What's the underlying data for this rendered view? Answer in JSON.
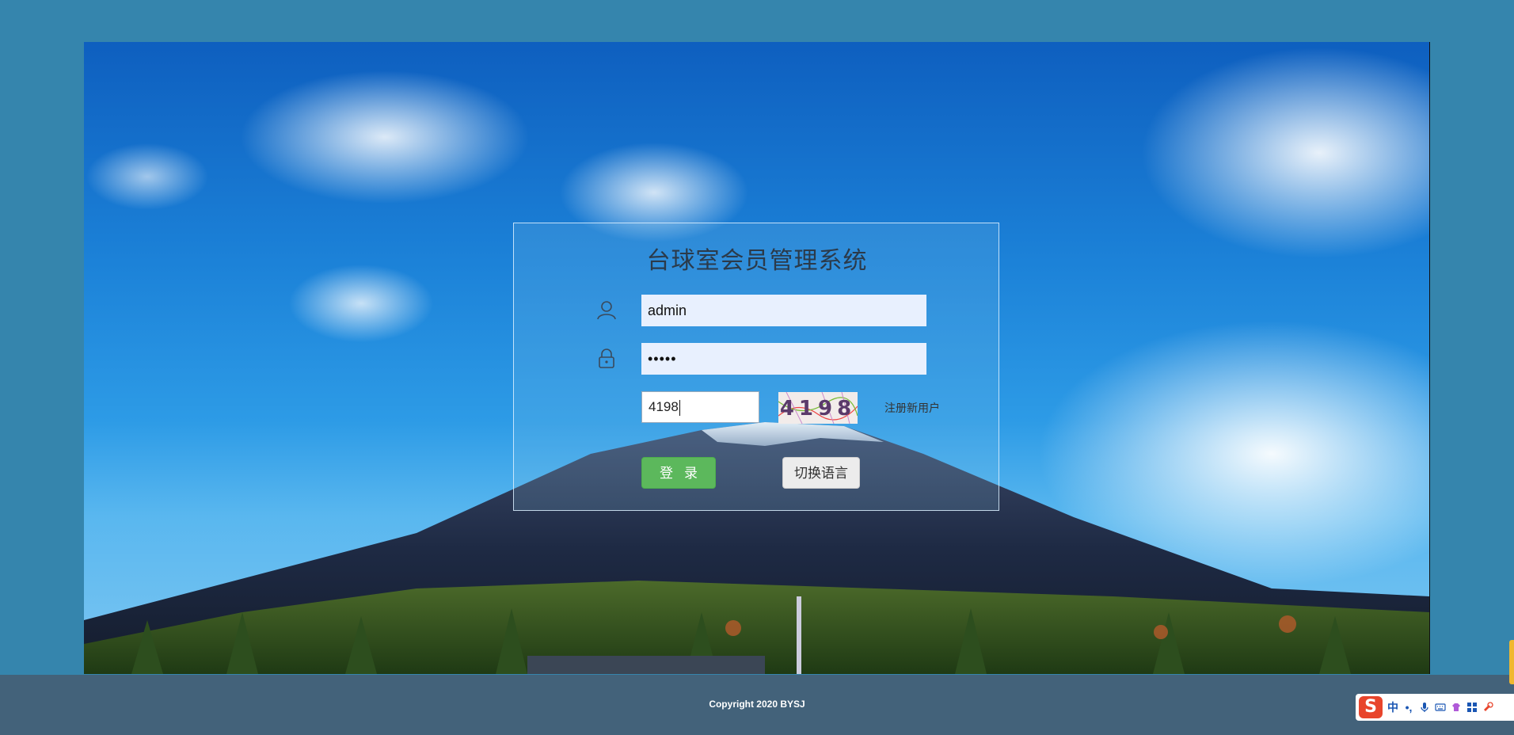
{
  "login": {
    "title": "台球室会员管理系统",
    "username_value": "admin",
    "password_value": "•••••",
    "captcha_value": "4198",
    "captcha_image_text": "4198",
    "register_label": "注册新用户",
    "login_button_label": "登录",
    "language_button_label": "切换语言"
  },
  "footer": {
    "copyright": "Copyright 2020 BYSJ"
  },
  "ime_toolbar": {
    "logo": "S",
    "mode": "中",
    "punct": "•,"
  },
  "icons": {
    "username": "user-icon",
    "password": "lock-icon",
    "mic": "microphone-icon",
    "keyboard": "keyboard-icon",
    "skin": "skin-icon",
    "apps": "grid-icon",
    "tools": "tools-icon"
  },
  "colors": {
    "page_background": "#3585ad",
    "footer_background": "#43627a",
    "login_button": "#5cb85c",
    "input_background": "#e8f0fe"
  }
}
